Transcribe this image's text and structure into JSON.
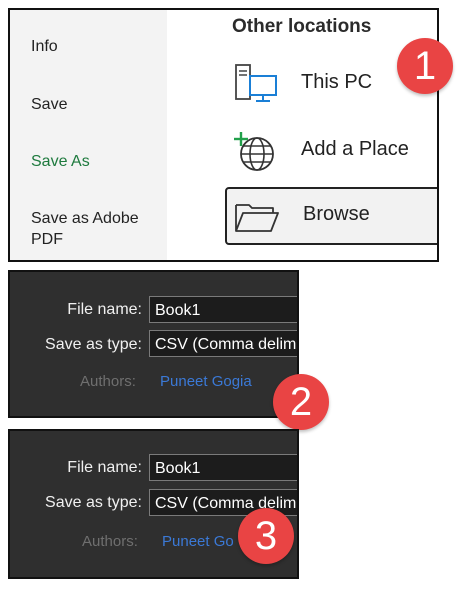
{
  "backstage": {
    "nav": {
      "info": "Info",
      "save": "Save",
      "save_as": "Save As",
      "save_as_adobe_pdf": "Save as Adobe PDF"
    },
    "section_title": "Other locations",
    "locations": {
      "this_pc": "This PC",
      "add_place": "Add a Place",
      "browse": "Browse"
    }
  },
  "dialog_2": {
    "file_name_label": "File name:",
    "file_name_value": "Book1",
    "save_type_label": "Save as type:",
    "save_type_value": "CSV (Comma delim",
    "authors_label": "Authors:",
    "authors_value": "Puneet Gogia"
  },
  "dialog_3": {
    "file_name_label": "File name:",
    "file_name_value": "Book1",
    "save_type_label": "Save as type:",
    "save_type_value": "CSV (Comma delim",
    "authors_label": "Authors:",
    "authors_value": "Puneet Go"
  },
  "badges": {
    "one": "1",
    "two": "2",
    "three": "3"
  },
  "colors": {
    "active_nav": "#1e7a3e",
    "badge": "#e94444",
    "dialog_bg": "#2f2f2f",
    "link": "#3b79d6"
  },
  "icons": {
    "this_pc": "computer-icon",
    "add_place": "globe-plus-icon",
    "browse": "folder-icon"
  }
}
